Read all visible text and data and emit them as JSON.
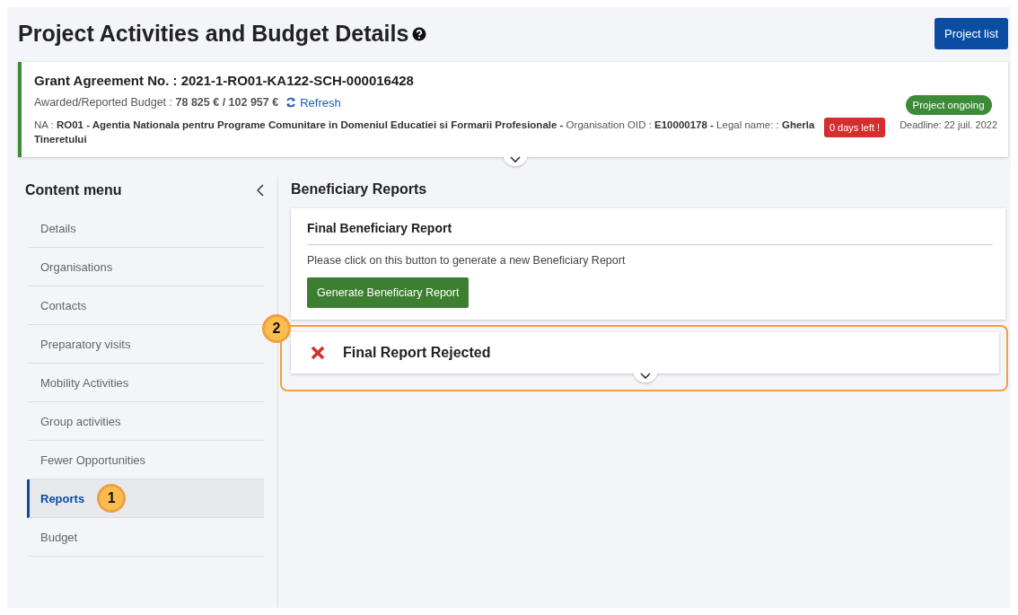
{
  "page": {
    "title": "Project Activities and Budget Details",
    "project_list_button": "Project list"
  },
  "grant": {
    "agreement": "Grant Agreement No. : 2021-1-RO01-KA122-SCH-000016428",
    "budget_label": "Awarded/Reported Budget : **78 825 € / 102 957 €**",
    "refresh": "Refresh",
    "details": "NA : **RO01 - Agentia Nationala pentru Programe Comunitare in Domeniul Educatiei si Formarii Profesionale -** Organisation OID : **E10000178 -** Legal name: : **Gherla Tineretului**",
    "days_left": "0 days left !",
    "status": "Project ongoing",
    "deadline": "Deadline: 22 juil. 2022",
    "expanded": false
  },
  "sidebar": {
    "title": "Content menu",
    "items": [
      {
        "label": "Details",
        "selected": false
      },
      {
        "label": "Organisations",
        "selected": false
      },
      {
        "label": "Contacts",
        "selected": false
      },
      {
        "label": "Preparatory visits",
        "selected": false
      },
      {
        "label": "Mobility Activities",
        "selected": false
      },
      {
        "label": "Group activities",
        "selected": false
      },
      {
        "label": "Fewer Opportunities",
        "selected": false
      },
      {
        "label": "Reports",
        "selected": true,
        "callout": "1"
      },
      {
        "label": "Budget",
        "selected": false
      }
    ]
  },
  "main": {
    "title": "Beneficiary Reports",
    "final_report": {
      "title": "Final Beneficiary Report",
      "text": "Please click on this button to generate a new Beneficiary Report",
      "button": "Generate Beneficiary Report"
    },
    "rejected": {
      "title": "Final Report Rejected",
      "callout": "2",
      "expanded": false
    }
  }
}
